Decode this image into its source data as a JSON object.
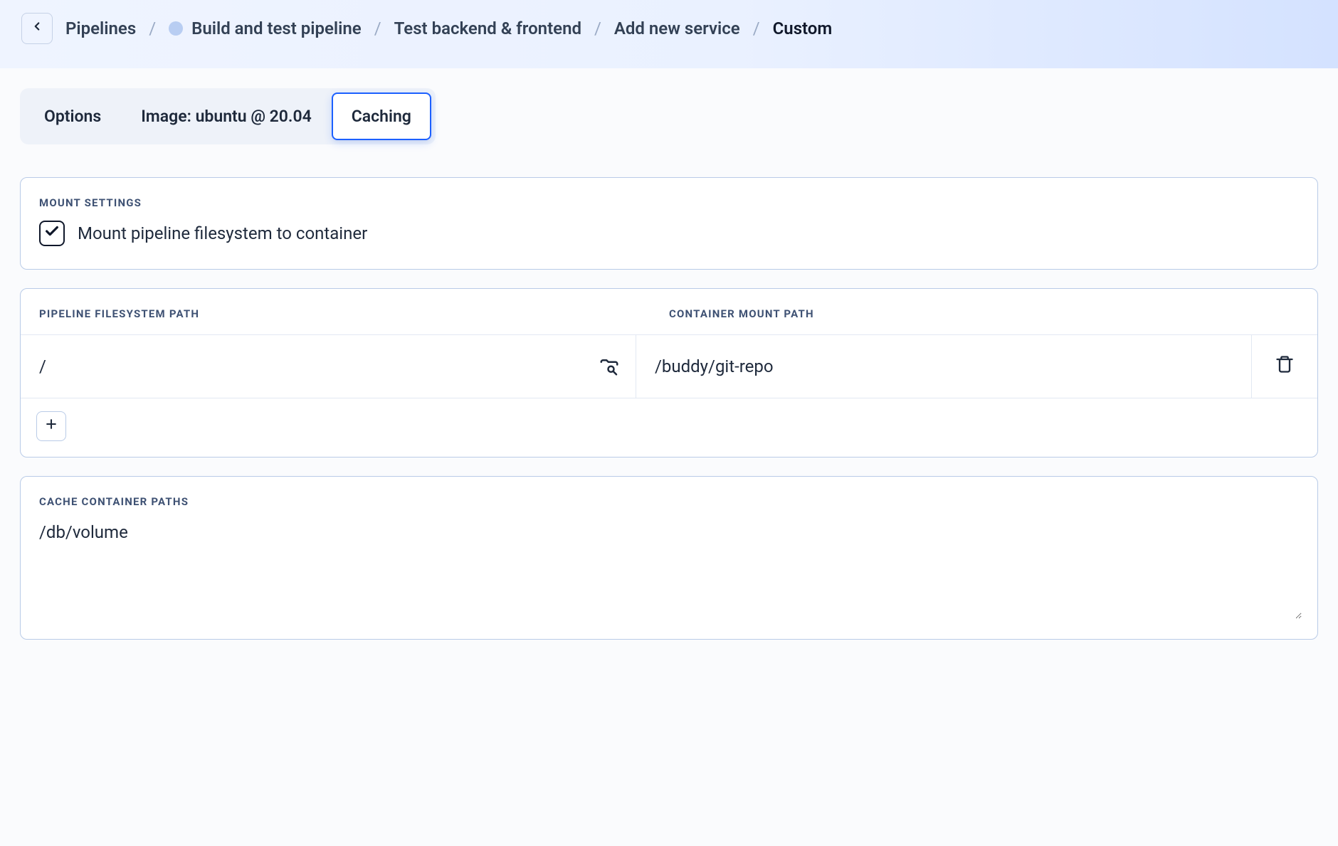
{
  "breadcrumbs": {
    "items": [
      {
        "label": "Pipelines"
      },
      {
        "label": "Build and test pipeline",
        "has_status": true
      },
      {
        "label": "Test backend & frontend"
      },
      {
        "label": "Add new service"
      }
    ],
    "current": "Custom"
  },
  "tabs": {
    "options": "Options",
    "image": "Image: ubuntu @ 20.04",
    "caching": "Caching"
  },
  "mount": {
    "section_title": "MOUNT SETTINGS",
    "checkbox_label": "Mount pipeline filesystem to container",
    "checked": true
  },
  "paths": {
    "header_left": "PIPELINE FILESYSTEM PATH",
    "header_right": "CONTAINER MOUNT PATH",
    "rows": [
      {
        "fs_path": "/",
        "mount_path": "/buddy/git-repo"
      }
    ]
  },
  "cache": {
    "section_title": "CACHE CONTAINER PATHS",
    "value": "/db/volume"
  }
}
